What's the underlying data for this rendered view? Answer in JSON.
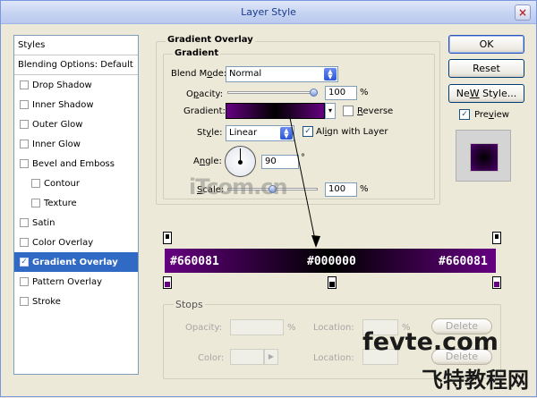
{
  "window": {
    "title": "Layer Style",
    "close_glyph": "×"
  },
  "styles_list": {
    "header": "Styles",
    "blending_default": "Blending Options: Default",
    "items": [
      {
        "label": "Drop Shadow",
        "checked": false
      },
      {
        "label": "Inner Shadow",
        "checked": false
      },
      {
        "label": "Outer Glow",
        "checked": false
      },
      {
        "label": "Inner Glow",
        "checked": false
      },
      {
        "label": "Bevel and Emboss",
        "checked": false
      },
      {
        "label": "Contour",
        "checked": false
      },
      {
        "label": "Texture",
        "checked": false
      },
      {
        "label": "Satin",
        "checked": false
      },
      {
        "label": "Color Overlay",
        "checked": false
      },
      {
        "label": "Gradient Overlay",
        "checked": true
      },
      {
        "label": "Pattern Overlay",
        "checked": false
      },
      {
        "label": "Stroke",
        "checked": false
      }
    ],
    "check_glyph": "✓"
  },
  "gradient_overlay": {
    "section_title": "Gradient Overlay",
    "group_title": "Gradient",
    "blend_mode": {
      "label_a": "Blend M",
      "label_u": "o",
      "label_b": "de:",
      "value": "Normal"
    },
    "opacity": {
      "label_a": "O",
      "label_u": "p",
      "label_b": "acity:",
      "value": "100",
      "unit": "%",
      "level": 1.0
    },
    "gradient": {
      "label": "Gradient:",
      "reverse_u": "R",
      "reverse_rest": "everse",
      "reverse_checked": false,
      "dd_glyph": "▾"
    },
    "style": {
      "label_a": "St",
      "label_u": "y",
      "label_b": "le:",
      "value": "Linear",
      "align_u": "i",
      "align_a": "Al",
      "align_b": "gn with Layer",
      "align_checked": true
    },
    "angle": {
      "label_a": "A",
      "label_u": "n",
      "label_b": "gle:",
      "value": "90",
      "unit": "°"
    },
    "scale": {
      "label_u": "S",
      "label_rest": "cale:",
      "value": "100",
      "unit": "%",
      "level": 0.5
    },
    "colors": {
      "start": "#660081",
      "mid": "#000000",
      "end": "#660081"
    }
  },
  "buttons": {
    "ok": "OK",
    "reset": "Reset",
    "new_style_u": "W",
    "new_style_a": "Ne",
    "new_style_b": " Style...",
    "preview_u": "v",
    "preview_a": "Pre",
    "preview_b": "iew",
    "preview_checked": true
  },
  "gradient_bar": {
    "left_label": "#660081",
    "mid_label": "#000000",
    "right_label": "#660081"
  },
  "stops": {
    "title": "Stops",
    "opacity_label": "Opacity:",
    "opacity_unit": "%",
    "location_label": "Location:",
    "location_unit": "%",
    "color_label": "Color:",
    "delete_label": "Delete",
    "delete_label_2": "Delete"
  },
  "watermarks": {
    "itcom": "iTcom.cn",
    "fevte": "fevte.com",
    "chinese": "飞特教程网"
  },
  "icons": {
    "dial": "angle-dial-icon",
    "arrow": "arrow-annotation"
  }
}
